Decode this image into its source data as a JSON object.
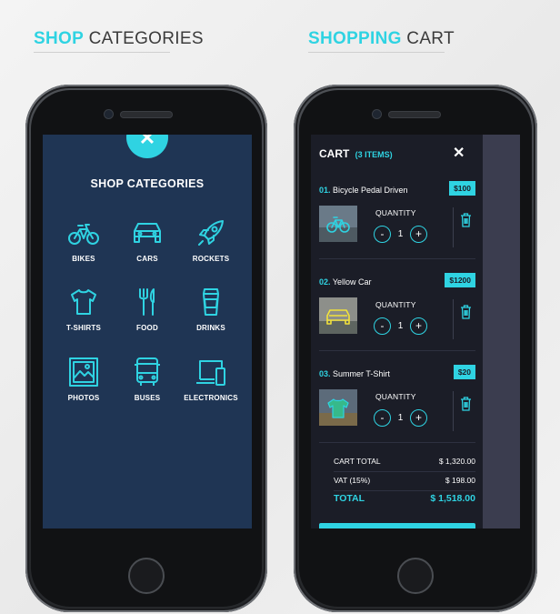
{
  "headings": {
    "left": {
      "accent": "SHOP",
      "rest": "CATEGORIES"
    },
    "right": {
      "accent": "SHOPPING",
      "rest": "CART"
    }
  },
  "categories_screen": {
    "close_symbol": "✕",
    "title": "SHOP CATEGORIES",
    "items": [
      {
        "label": "BIKES",
        "icon": "bike-icon"
      },
      {
        "label": "CARS",
        "icon": "car-icon"
      },
      {
        "label": "ROCKETS",
        "icon": "rocket-icon"
      },
      {
        "label": "T-SHIRTS",
        "icon": "tshirt-icon"
      },
      {
        "label": "FOOD",
        "icon": "cutlery-icon"
      },
      {
        "label": "DRINKS",
        "icon": "coffee-cup-icon"
      },
      {
        "label": "PHOTOS",
        "icon": "photo-icon"
      },
      {
        "label": "BUSES",
        "icon": "bus-icon"
      },
      {
        "label": "ELECTRONICS",
        "icon": "devices-icon"
      }
    ]
  },
  "cart_screen": {
    "title": "CART",
    "count": "(3 ITEMS)",
    "close_symbol": "✕",
    "quantity_label": "QUANTITY",
    "minus": "-",
    "plus": "+",
    "items": [
      {
        "num": "01.",
        "name": "Bicycle Pedal Driven",
        "price": "$100",
        "qty": "1",
        "thumb_icon": "bike-icon"
      },
      {
        "num": "02.",
        "name": "Yellow Car",
        "price": "$1200",
        "qty": "1",
        "thumb_icon": "car-icon"
      },
      {
        "num": "03.",
        "name": "Summer T-Shirt",
        "price": "$20",
        "qty": "1",
        "thumb_icon": "tshirt-icon"
      }
    ],
    "totals": {
      "cart_total_label": "CART TOTAL",
      "cart_total_value": "$ 1,320.00",
      "vat_label": "VAT (15%)",
      "vat_value": "$ 198.00",
      "total_label": "TOTAL",
      "total_value": "$ 1,518.00"
    }
  },
  "colors": {
    "accent": "#2fd3e2",
    "category_bg": "#1f3554",
    "cart_bg": "#1b1d27"
  }
}
